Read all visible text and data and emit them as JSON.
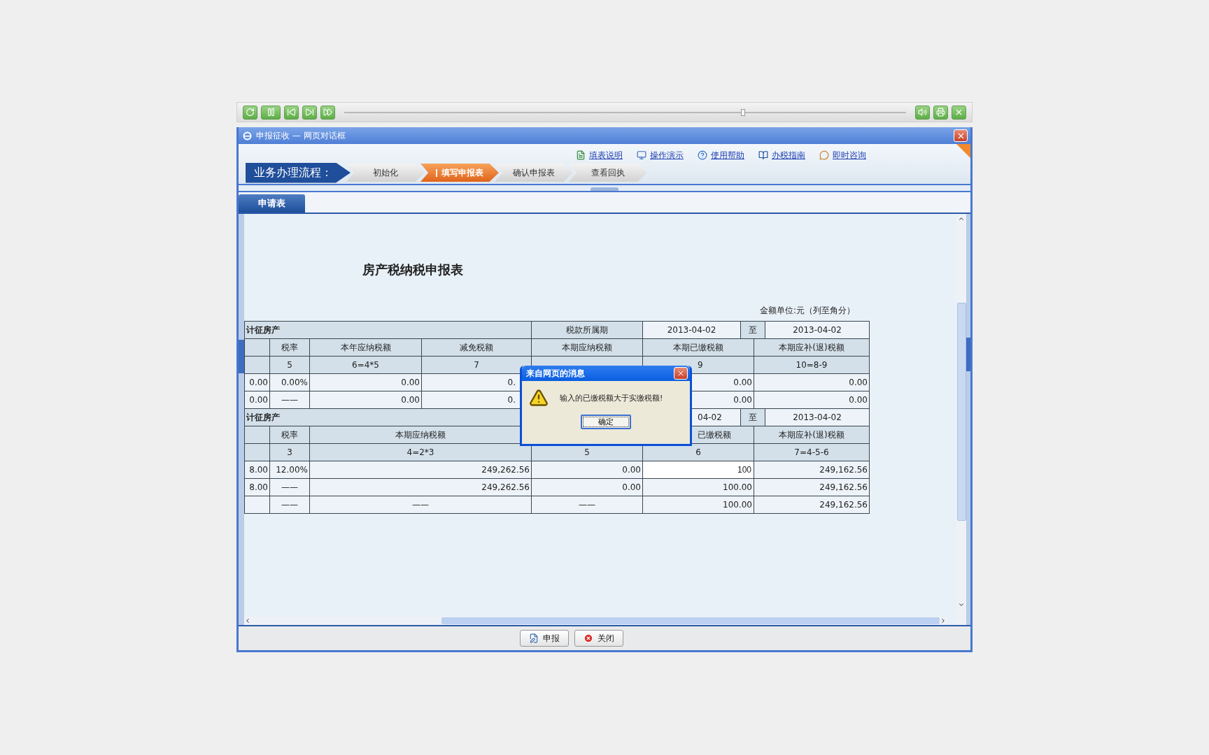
{
  "player": {
    "seek": {
      "level": 0.71
    }
  },
  "window": {
    "title": "申报征收 — 网页对话框"
  },
  "flow": {
    "label": "业务办理流程：",
    "steps": [
      {
        "label": "初始化",
        "selected": false
      },
      {
        "label": "填写申报表",
        "selected": true
      },
      {
        "label": "确认申报表",
        "selected": false
      },
      {
        "label": "查看回执",
        "selected": false
      }
    ]
  },
  "links": [
    {
      "label": "填表说明",
      "kind": "doc"
    },
    {
      "label": "操作演示",
      "kind": "screen"
    },
    {
      "label": "使用帮助",
      "kind": "help"
    },
    {
      "label": "办税指南",
      "kind": "book"
    },
    {
      "label": "即时咨询",
      "kind": "chat"
    }
  ],
  "tabs": [
    {
      "label": "申请表",
      "selected": true
    }
  ],
  "form": {
    "title": "房产税纳税申报表",
    "unit": "金额单位:元（列至角分）",
    "sections": [
      {
        "rows": [
          {
            "kind": "head",
            "cells": [
              {
                "text": "计征房产",
                "colspan": 4
              },
              {
                "text": "税款所属期"
              },
              {
                "text": "2013-04-02"
              },
              {
                "text": "至",
                "colspan": 2
              },
              {
                "text": "2013-04-02"
              }
            ]
          },
          {
            "kind": "colhead",
            "cells": [
              null,
              {
                "text": "税率"
              },
              {
                "text": "本年应纳税额"
              },
              {
                "text": "减免税额"
              },
              {
                "text": "本期应纳税额"
              },
              {
                "text": "本期已缴税额",
                "colspan": 2
              },
              {
                "text": "本期应补(退)税额",
                "colspan": 2
              }
            ]
          },
          {
            "kind": "index",
            "cells": [
              null,
              {
                "text": "5"
              },
              {
                "text": "6=4*5"
              },
              {
                "text": "7"
              },
              null,
              {
                "text": "9",
                "kind": "after",
                "colspan": 2
              },
              {
                "text": "10=8-9",
                "colspan": 2
              }
            ]
          },
          {
            "kind": "data",
            "cells": [
              {
                "text": "0.00"
              },
              {
                "text": "0.00%"
              },
              {
                "text": "0.00"
              },
              {
                "text": "0.",
                "kind": "before"
              },
              null,
              {
                "text": "0.00",
                "colspan": 2
              },
              {
                "text": "0.00",
                "colspan": 2
              }
            ]
          },
          {
            "kind": "data",
            "cells": [
              {
                "text": "0.00"
              },
              {
                "text": "——",
                "kind": "dash"
              },
              {
                "text": "0.00"
              },
              {
                "text": "0.",
                "kind": "before"
              },
              null,
              {
                "text": "0.00",
                "colspan": 2
              },
              {
                "text": "0.00",
                "colspan": 2
              }
            ]
          }
        ]
      },
      {
        "rows": [
          {
            "kind": "head",
            "cells": [
              {
                "text": "计征房产",
                "colspan": 4
              },
              null,
              {
                "text": "04-02",
                "kind": "after"
              },
              {
                "text": "至",
                "colspan": 2
              },
              {
                "text": "2013-04-02"
              }
            ]
          },
          {
            "kind": "colhead",
            "cells": [
              null,
              {
                "text": "税率"
              },
              {
                "text": "本期应纳税额",
                "colspan": 2
              },
              null,
              {
                "text": "已缴税额",
                "kind": "after",
                "colspan": 2
              },
              {
                "text": "本期应补(退)税额",
                "colspan": 2
              }
            ]
          },
          {
            "kind": "index",
            "cells": [
              null,
              {
                "text": "3"
              },
              {
                "text": "4=2*3",
                "colspan": 2
              },
              {
                "text": "5"
              },
              {
                "text": "6",
                "colspan": 2
              },
              {
                "text": "7=4-5-6",
                "colspan": 2
              }
            ]
          },
          {
            "kind": "data",
            "cells": [
              {
                "text": "8.00"
              },
              {
                "text": "12.00%"
              },
              {
                "text": "249,262.56",
                "colspan": 2
              },
              {
                "text": "0.00"
              },
              {
                "text": "100",
                "kind": "input",
                "colspan": 2
              },
              {
                "text": "249,162.56",
                "colspan": 2
              }
            ]
          },
          {
            "kind": "data",
            "cells": [
              {
                "text": "8.00"
              },
              {
                "text": "——",
                "kind": "dash"
              },
              {
                "text": "249,262.56",
                "colspan": 2
              },
              {
                "text": "0.00"
              },
              {
                "text": "100.00",
                "colspan": 2
              },
              {
                "text": "249,162.56",
                "colspan": 2
              }
            ]
          },
          {
            "kind": "data",
            "cells": [
              null,
              {
                "text": "——",
                "kind": "dash"
              },
              {
                "text": "——",
                "kind": "dash",
                "colspan": 2
              },
              {
                "text": "——",
                "kind": "dash"
              },
              {
                "text": "100.00",
                "colspan": 2
              },
              {
                "text": "249,162.56",
                "colspan": 2
              }
            ]
          }
        ]
      }
    ]
  },
  "dialog": {
    "title": "来自网页的消息",
    "message": "输入的已缴税额大于实缴税额!",
    "button": "确定"
  },
  "buttons": [
    {
      "label": "申报",
      "kind": "submit"
    },
    {
      "label": "关闭",
      "kind": "close"
    }
  ]
}
